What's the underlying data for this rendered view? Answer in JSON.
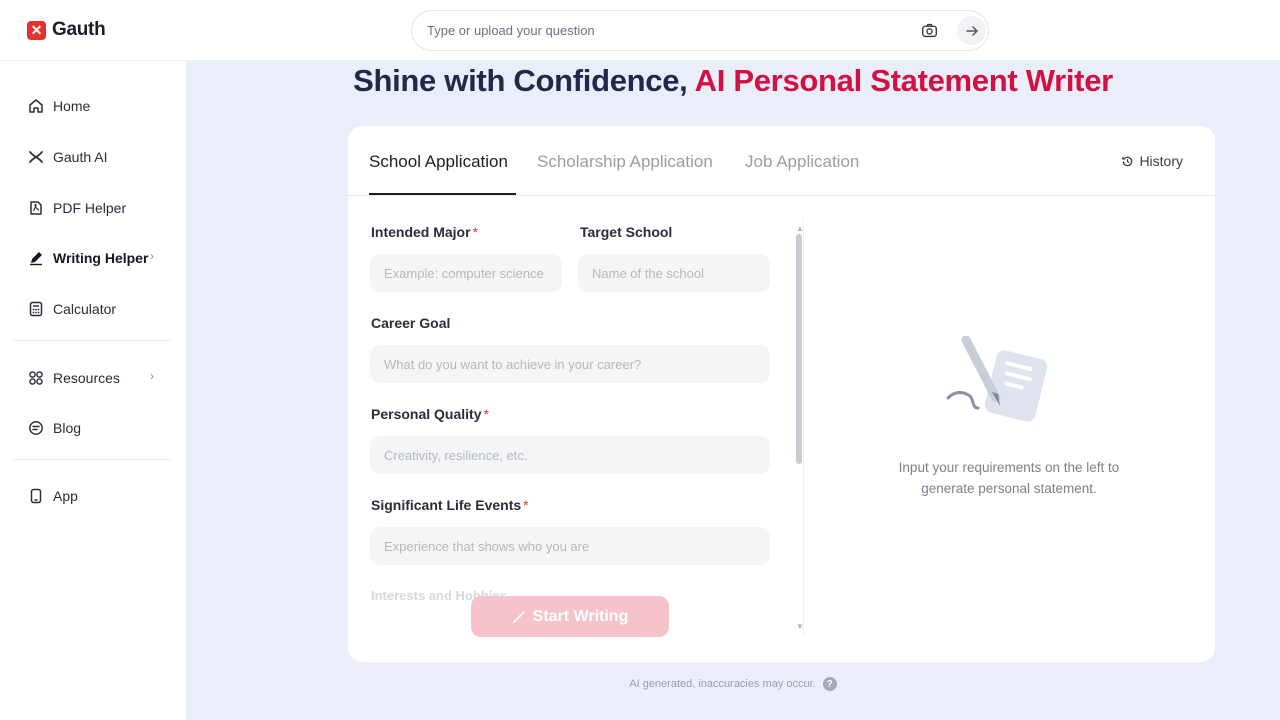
{
  "brand": {
    "name": "Gauth",
    "logo_mark": "✕"
  },
  "search": {
    "placeholder": "Type or upload your question"
  },
  "sidebar": {
    "items": [
      {
        "label": "Home",
        "icon": "home-icon"
      },
      {
        "label": "Gauth AI",
        "icon": "ai-icon"
      },
      {
        "label": "PDF Helper",
        "icon": "pdf-icon"
      },
      {
        "label": "Writing Helper",
        "icon": "pen-icon",
        "active": true
      },
      {
        "label": "Calculator",
        "icon": "calculator-icon"
      },
      {
        "label": "Resources",
        "icon": "grid-icon"
      },
      {
        "label": "Blog",
        "icon": "blog-icon"
      },
      {
        "label": "App",
        "icon": "phone-icon"
      }
    ],
    "chevron": "›"
  },
  "headline": {
    "main": "Shine with Confidence, ",
    "accent": "AI Personal Statement Writer"
  },
  "tabs": [
    {
      "label": "School Application",
      "active": true
    },
    {
      "label": "Scholarship Application"
    },
    {
      "label": "Job Application"
    }
  ],
  "history_label": "History",
  "form": {
    "intended_major": {
      "label": "Intended Major",
      "placeholder": "Example: computer science",
      "required": "*"
    },
    "target_school": {
      "label": "Target School",
      "placeholder": "Name of the school"
    },
    "career_goal": {
      "label": "Career Goal",
      "placeholder": "What do you want to achieve in your career?"
    },
    "personal_quality": {
      "label": "Personal Quality",
      "placeholder": "Creativity, resilience, etc.",
      "required": "*"
    },
    "life_events": {
      "label": "Significant Life Events",
      "placeholder": "Experience that shows who you are",
      "required": "*"
    },
    "interests": {
      "label": "Interests and Hobbies"
    }
  },
  "start_button": "Start Writing",
  "empty_state": {
    "line1": "Input your requirements on the left to",
    "line2": "generate personal statement."
  },
  "disclaimer": "AI generated, inaccuracies may occur.",
  "colors": {
    "brand_red": "#e5322d",
    "accent": "#d21140",
    "background": "#eaedfa"
  }
}
